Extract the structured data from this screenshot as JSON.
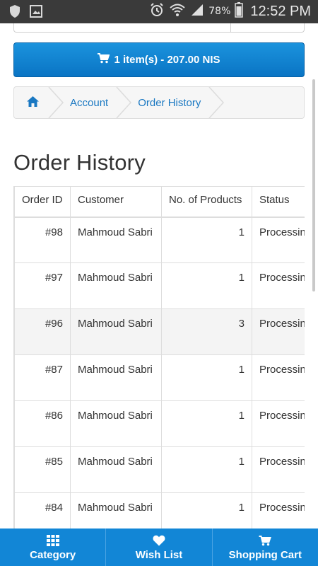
{
  "status_bar": {
    "battery": "78%",
    "time": "12:52 PM",
    "icons": [
      "shield-icon",
      "gallery-icon",
      "alarm-icon",
      "wifi-icon",
      "signal-icon",
      "battery-icon"
    ]
  },
  "cart": {
    "label": "1 item(s) - 207.00 NIS",
    "icon": "cart-icon"
  },
  "breadcrumb": {
    "home_icon": "home-icon",
    "items": [
      "Account",
      "Order History"
    ]
  },
  "page": {
    "title": "Order History"
  },
  "table": {
    "columns": [
      "Order ID",
      "Customer",
      "No. of Products",
      "Status"
    ],
    "rows": [
      {
        "order_id": "#98",
        "customer": "Mahmoud Sabri",
        "products": "1",
        "status": "Processing"
      },
      {
        "order_id": "#97",
        "customer": "Mahmoud Sabri",
        "products": "1",
        "status": "Processing"
      },
      {
        "order_id": "#96",
        "customer": "Mahmoud Sabri",
        "products": "3",
        "status": "Processing"
      },
      {
        "order_id": "#87",
        "customer": "Mahmoud Sabri",
        "products": "1",
        "status": "Processing"
      },
      {
        "order_id": "#86",
        "customer": "Mahmoud Sabri",
        "products": "1",
        "status": "Processing"
      },
      {
        "order_id": "#85",
        "customer": "Mahmoud Sabri",
        "products": "1",
        "status": "Processing"
      },
      {
        "order_id": "#84",
        "customer": "Mahmoud Sabri",
        "products": "1",
        "status": "Processing"
      }
    ]
  },
  "bottom_nav": {
    "items": [
      {
        "label": "Category",
        "icon": "grid-icon"
      },
      {
        "label": "Wish List",
        "icon": "heart-icon"
      },
      {
        "label": "Shopping Cart",
        "icon": "cart-icon"
      }
    ]
  },
  "colors": {
    "accent": "#1286d6",
    "link": "#1a78c2",
    "status_bar": "#3a3a3a"
  }
}
